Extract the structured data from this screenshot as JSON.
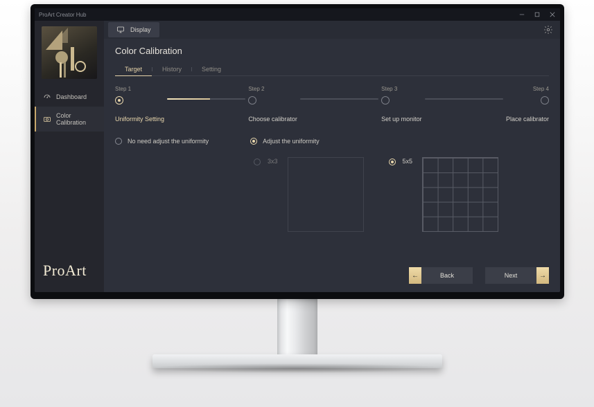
{
  "window": {
    "title": "ProArt Creator Hub"
  },
  "brand": "ProArt",
  "topbar": {
    "page_chip": "Display"
  },
  "sidebar": {
    "items": [
      {
        "label": "Dashboard",
        "icon": "gauge-icon",
        "active": false
      },
      {
        "label": "Color Calibration",
        "icon": "camera-icon",
        "active": true
      }
    ]
  },
  "page": {
    "title": "Color Calibration",
    "tabs": [
      {
        "label": "Target",
        "active": true
      },
      {
        "label": "History",
        "active": false
      },
      {
        "label": "Setting",
        "active": false
      }
    ],
    "steps": [
      {
        "id": "Step 1",
        "title": "Uniformity Setting",
        "active": true
      },
      {
        "id": "Step 2",
        "title": "Choose calibrator",
        "active": false
      },
      {
        "id": "Step 3",
        "title": "Set up monitor",
        "active": false
      },
      {
        "id": "Step 4",
        "title": "Place calibrator",
        "active": false
      }
    ],
    "uniformity_options": [
      {
        "label": "No need adjust the uniformity",
        "selected": false
      },
      {
        "label": "Adjust the uniformity",
        "selected": true
      }
    ],
    "grid_options": [
      {
        "label": "3x3",
        "selected": false,
        "enabled": false
      },
      {
        "label": "5x5",
        "selected": true,
        "enabled": true
      }
    ],
    "back_label": "Back",
    "next_label": "Next"
  }
}
